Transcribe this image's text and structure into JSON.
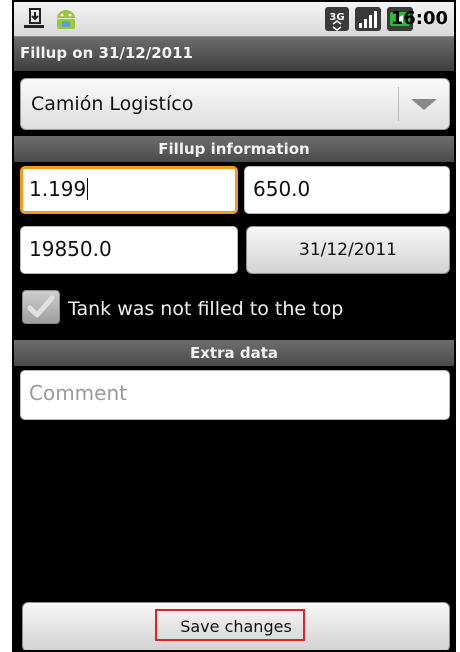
{
  "status_bar": {
    "time": "16:00",
    "network_label": "3G",
    "icons": [
      "usb-debug-icon",
      "android-icon",
      "network-3g-icon",
      "signal-icon",
      "battery-icon"
    ],
    "accent": "#2dbe2d"
  },
  "title_bar": {
    "title": "Fillup on 31/12/2011"
  },
  "vehicle_spinner": {
    "selected": "Camión Logistíco"
  },
  "sections": {
    "fillup_information": "Fillup information",
    "extra_data": "Extra data"
  },
  "fields": {
    "price": "1.199",
    "volume": "650.0",
    "odometer": "19850.0",
    "date": "31/12/2011"
  },
  "partial_fill": {
    "label": "Tank was not filled to the top",
    "checked": true
  },
  "comment": {
    "placeholder": "Comment",
    "value": ""
  },
  "actions": {
    "save_label": "Save changes"
  },
  "colors": {
    "focus": "#f39c1b",
    "highlight": "#e02424"
  }
}
